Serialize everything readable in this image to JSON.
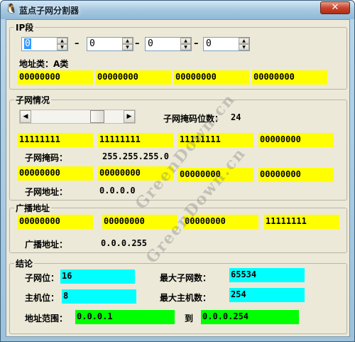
{
  "window": {
    "title": "蓝点子网分割器",
    "close_glyph": "✕",
    "app_icon": "penguin-icon"
  },
  "ip_section": {
    "legend": "IP段",
    "octets": [
      "0",
      "0",
      "0",
      "0"
    ],
    "separator": "–",
    "class_label": "地址类：A类",
    "binary": [
      "00000000",
      "00000000",
      "00000000",
      "00000000"
    ]
  },
  "subnet_section": {
    "legend": "子网情况",
    "mask_bits_label": "子网掩码位数：",
    "mask_bits_value": "24",
    "mask_binary": [
      "11111111",
      "11111111",
      "11111111",
      "00000000"
    ],
    "mask_label": "子网掩码：",
    "mask_value": "255.255.255.0",
    "addr_binary": [
      "00000000",
      "00000000",
      "00000000",
      "00000000"
    ],
    "addr_label": "子网地址：",
    "addr_value": "0.0.0.0",
    "slider_fraction": 0.75
  },
  "broadcast_section": {
    "legend": "广播地址",
    "binary": [
      "00000000",
      "00000000",
      "00000000",
      "11111111"
    ],
    "label": "广播地址：",
    "value": "0.0.0.255"
  },
  "result_section": {
    "legend": "结论",
    "subnet_bits_label": "子网位：",
    "subnet_bits_value": "16",
    "max_subnets_label": "最大子网数：",
    "max_subnets_value": "65534",
    "host_bits_label": "主机位：",
    "host_bits_value": "8",
    "max_hosts_label": "最大主机数：",
    "max_hosts_value": "254",
    "range_label": "地址范围：",
    "range_start": "0.0.0.1",
    "range_to": "到",
    "range_end": "0.0.0.254"
  },
  "watermarks": [
    "GreenDown.cn",
    "GreenDown.cn"
  ],
  "colors": {
    "binary_box": "#ffff00",
    "bits_box": "#00ffff",
    "range_box": "#00ff00"
  }
}
